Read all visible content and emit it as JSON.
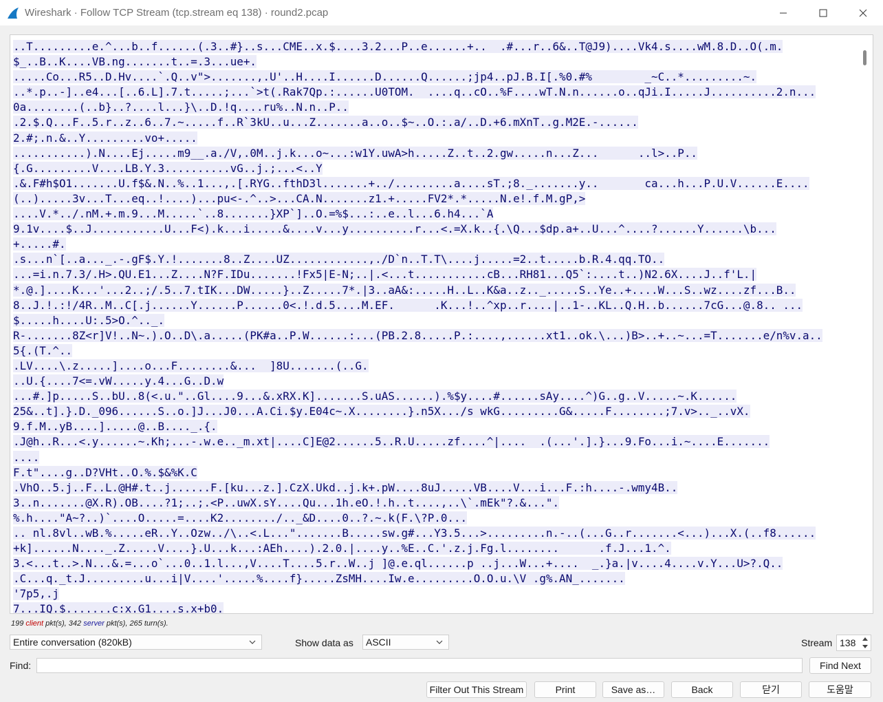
{
  "window": {
    "title": "Wireshark · Follow TCP Stream (tcp.stream eq 138) · round2.pcap",
    "icon": "wireshark-fin-icon",
    "controls": [
      "minimize-icon",
      "maximize-icon",
      "close-icon"
    ]
  },
  "stream": {
    "lines": [
      "..T.........e.^...b..f......(.3..#}..s...CME..x.$....3.2...P..e......+..  .#...r..6&..T@J9)....Vk4.s....wM.8.D..O(.m.",
      "$_..B..K....VB.ng.......t..=.3...ue+.",
      ".....Co...R5..D.Hv....`.Q..v\">.......,.U'..H....I......D......Q......;jp4..pJ.B.I[.%0.#%        _~C..*.........~.",
      "..*.p..-]..e4...[..6.L].7.t.....;...`>t(.Rak7Qp.:......U0TOM.  ....q..cO..%F....wT.N.n......o..qJi.I.....J..........2.n...",
      "0a........(..b}..?....l...}\\..D.!q....ru%..N.n..P..",
      ".2.$.Q...F..5.r..z..6..7.~.....f..R`3kU..u...Z.......a..o..$~..O.:.a/..D.+6.mXnT..g.M2E.-......",
      "2.#;.n.&..Y.........vo+.....",
      "...........).N....Ej.....m9__.a./V,.0M..j.k...o~...:w1Y.uwA>h.....Z..t..2.gw.....n...Z...      ..l>..P..",
      "{.G.........V....LB.Y.3..........vG..j.;...<..Y",
      ".&.F#h$O1.......U.f$&.N..%..1...,.[.RYG..fthD3l.......+../.........a....sT.;8._.......y..       ca...h...P.U.V......E....",
      "(..).....3v...T...eq..!....)...pu<-.^..>...CA.N.......z1.+.....FV2*.*.....N.e!.f.M.gP,>",
      "....V.*../.nM.+.m.9...M.....`..8.......}XP`]..O.=%$...:..e..l...6.h4...`A",
      "9.1v....$..J...........U...F<).k...i.....&....v...y..........r...<.=X.k..{.\\Q...$dp.a+..U...^....?......Y......\\b...",
      "+.....#.",
      ".s...n`[..a..._.-.gF$.Y.!.......8..Z....UZ............,./D`n..T.T\\....j.....=2..t.....b.R.4.qq.TO..",
      "...=i.n.7.3/.H>.QU.E1...Z....N?F.IDu.......!Fx5|E-N;..|.<...t...........cB...RH81...Q5`:....t..)N2.6X....J..f'L.|",
      "*.@.]....K...'...2..;/.5..7.tIK...DW.....}..Z.....7*.|3..aA&:.....H..L..K&a..z.._.....S..Ye..+....W...S..wz....zf...B..",
      "8..J.!.:!/4R..M..C[.j......Y......P......0<.!.d.5....M.EF.      .K...!..^xp..r....|..1-..KL..Q.H..b......7cG...@.8.. ...",
      "$.....h....U:.5>O.^.._.",
      "R-.......8Z<r]V!..N~.).O..D\\.a.....(PK#a..P.W......:...(PB.2.8.....P.:....,......xt1..ok.\\...)B>..+..~...=T.......e/n%v.a..",
      "5{.(T.^..",
      ".LV....\\.z.....]....o...F........&...  ]8U.......(..G.",
      "..U.{....7<=.vW.....y.4...G..D.w",
      "...#.]p.....S..bU..8(<.u.\"..Gl....9...&.xRX.K].......S.uAS......).%$y....#......sAy....^)G..g..V.....~.K......",
      "25&..t].}.D._096......S..o.]J...J0...A.Ci.$y.E04c~.X........}.n5X.../s wkG.........G&.....F........;7.v>.._..vX.",
      "9.f.M..yB....].....@..B...._.{.",
      ".J@h..R...<.y......~.Kh;...-.w.e.._m.xt|....C]E@2......5..R.U.....zf....^|....  .(...'.].}...9.Fo...i.~....E.......",
      "....",
      "F.t\"....g..D?VHt..O.%.$&%K.C",
      ".VhO..5.j..F..L.@H#.t..j......F.[ku...z.].CzX.Ukd..j.k+.pW....8uJ.....VB....V...i...F.:h....-.wmy4B..",
      "3..n.......@X.R).OB....?1;..;.<P..uwX.sY....Qu...1h.eO.!.h..t....,..\\`.mEk\"?.&...\".",
      "%.h....\"A~?..)`....O.....=....K2......../.._&D....0..?.~.k(F.\\?P.0...",
      ".. nl.8vl..wB.%.....eR..Y..Ozw../\\..<.L...\".......B.....sw.g#...Y3.5...>.........n.-..(...G..r.......<...)...X.(..f8......",
      "+k]......N...._.Z.....V....}.U...k...:AEh....).2.0.|....y..%E..C.'.z.j.Fg.l........      .f.J...1.^.",
      "3.<...t..>.N...&.=...o`...0..1.l...,V....T....5.r..W..j ]@.e.ql......p ..j...W...+....  _.}a.|v....4....v.Y...U>?.Q..",
      ".C...q._t.J.........u...i|V....'.....%....f}.....ZsMH....Iw.e.........O.O.u.\\V .g%.AN_.......",
      "'7p5,.j",
      "7...IQ.$.......c:x.G1....s.x+b0."
    ]
  },
  "stats": {
    "prefix": "199",
    "client_word": "client",
    "mid": "pkt(s), 342",
    "server_word": "server",
    "suffix": "pkt(s), 265 turn(s)."
  },
  "controls": {
    "conversation_select": "Entire conversation (820kB)",
    "show_data_label": "Show data as",
    "show_data_select": "ASCII",
    "stream_label": "Stream",
    "stream_value": "138",
    "find_label": "Find:",
    "find_value": "",
    "find_next": "Find Next"
  },
  "buttons": {
    "filter_out": "Filter Out This Stream",
    "print": "Print",
    "save_as": "Save as…",
    "back": "Back",
    "close": "닫기",
    "help": "도움말"
  }
}
